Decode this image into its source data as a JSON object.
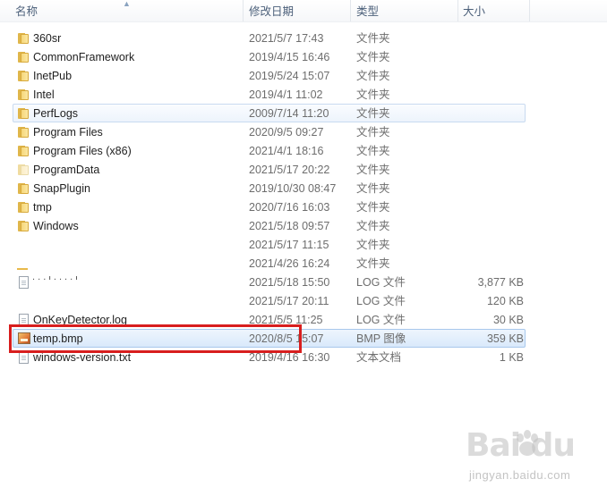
{
  "columns": {
    "name": "名称",
    "date": "修改日期",
    "type": "类型",
    "size": "大小"
  },
  "rows": [
    {
      "name": "360sr",
      "date": "2021/5/7 17:43",
      "type": "文件夹",
      "size": "",
      "icon": "folder-icon"
    },
    {
      "name": "CommonFramework",
      "date": "2019/4/15 16:46",
      "type": "文件夹",
      "size": "",
      "icon": "folder-icon"
    },
    {
      "name": "InetPub",
      "date": "2019/5/24 15:07",
      "type": "文件夹",
      "size": "",
      "icon": "folder-icon"
    },
    {
      "name": "Intel",
      "date": "2019/4/1 11:02",
      "type": "文件夹",
      "size": "",
      "icon": "folder-icon"
    },
    {
      "name": "PerfLogs",
      "date": "2009/7/14 11:20",
      "type": "文件夹",
      "size": "",
      "icon": "folder-icon",
      "state": "hover"
    },
    {
      "name": "Program Files",
      "date": "2020/9/5 09:27",
      "type": "文件夹",
      "size": "",
      "icon": "folder-icon"
    },
    {
      "name": "Program Files (x86)",
      "date": "2021/4/1 18:16",
      "type": "文件夹",
      "size": "",
      "icon": "folder-icon"
    },
    {
      "name": "ProgramData",
      "date": "2021/5/17 20:22",
      "type": "文件夹",
      "size": "",
      "icon": "folder-icon-faded"
    },
    {
      "name": "SnapPlugin",
      "date": "2019/10/30 08:47",
      "type": "文件夹",
      "size": "",
      "icon": "folder-icon"
    },
    {
      "name": "tmp",
      "date": "2020/7/16 16:03",
      "type": "文件夹",
      "size": "",
      "icon": "folder-icon"
    },
    {
      "name": "Windows",
      "date": "2021/5/18 09:57",
      "type": "文件夹",
      "size": "",
      "icon": "folder-icon"
    },
    {
      "name": "",
      "date": "2021/5/17 11:15",
      "type": "文件夹",
      "size": "",
      "icon": ""
    },
    {
      "name": "",
      "date": "2021/4/26 16:24",
      "type": "文件夹",
      "size": "",
      "icon": ""
    },
    {
      "name": "",
      "date": "2021/5/18 15:50",
      "type": "LOG 文件",
      "size": "3,877 KB",
      "icon": "file-icon"
    },
    {
      "name": "",
      "date": "2021/5/17 20:11",
      "type": "LOG 文件",
      "size": "120 KB",
      "icon": ""
    },
    {
      "name": "OnKeyDetector.log",
      "date": "2021/5/5 11:25",
      "type": "LOG 文件",
      "size": "30 KB",
      "icon": "file-icon"
    },
    {
      "name": "temp.bmp",
      "date": "2020/8/5 15:07",
      "type": "BMP 图像",
      "size": "359 KB",
      "icon": "image-icon",
      "state": "selected"
    },
    {
      "name": "windows-version.txt",
      "date": "2019/4/16 16:30",
      "type": "文本文档",
      "size": "1 KB",
      "icon": "file-icon"
    }
  ],
  "watermark": {
    "logo": "Bai du",
    "url": "jingyan.baidu.com"
  }
}
